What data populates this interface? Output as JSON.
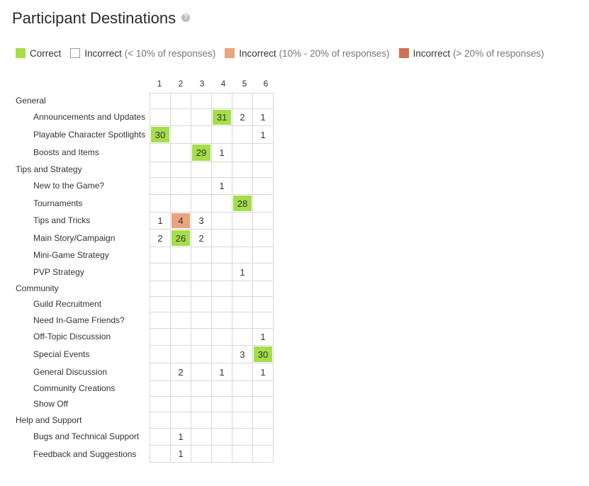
{
  "title": "Participant Destinations",
  "help_icon": "question-circle-icon",
  "colors": {
    "correct": "#a6dd4a",
    "incorrect_low": "#ffffff",
    "incorrect_mid": "#e8a47c",
    "incorrect_high": "#cd7253",
    "grid": "#d8d8d8"
  },
  "legend": {
    "correct": "Correct",
    "incorrect_label": "Incorrect",
    "incorrect_low_range": "(< 10% of responses)",
    "incorrect_mid_range": "(10% - 20% of responses)",
    "incorrect_high_range": "(> 20% of responses)"
  },
  "columns": [
    "1",
    "2",
    "3",
    "4",
    "5",
    "6"
  ],
  "rows": [
    {
      "label": "General",
      "type": "category",
      "cells": [
        "",
        "",
        "",
        "",
        "",
        ""
      ],
      "correct": null
    },
    {
      "label": "Announcements and Updates",
      "type": "sub",
      "cells": [
        "",
        "",
        "",
        "31",
        "2",
        "1"
      ],
      "correct": 3
    },
    {
      "label": "Playable Character Spotlights",
      "type": "sub",
      "cells": [
        "30",
        "",
        "",
        "",
        "",
        "1"
      ],
      "correct": 0
    },
    {
      "label": "Boosts and Items",
      "type": "sub",
      "cells": [
        "",
        "",
        "29",
        "1",
        "",
        ""
      ],
      "correct": 2
    },
    {
      "label": "Tips and Strategy",
      "type": "category",
      "cells": [
        "",
        "",
        "",
        "",
        "",
        ""
      ],
      "correct": null
    },
    {
      "label": "New to the Game?",
      "type": "sub",
      "cells": [
        "",
        "",
        "",
        "1",
        "",
        ""
      ],
      "correct": null
    },
    {
      "label": "Tournaments",
      "type": "sub",
      "cells": [
        "",
        "",
        "",
        "",
        "28",
        ""
      ],
      "correct": 4
    },
    {
      "label": "Tips and Tricks",
      "type": "sub",
      "cells": [
        "1",
        "4",
        "3",
        "",
        "",
        ""
      ],
      "correct": null,
      "incorrect_mid": 1
    },
    {
      "label": "Main Story/Campaign",
      "type": "sub",
      "cells": [
        "2",
        "26",
        "2",
        "",
        "",
        ""
      ],
      "correct": 1
    },
    {
      "label": "Mini-Game Strategy",
      "type": "sub",
      "cells": [
        "",
        "",
        "",
        "",
        "",
        ""
      ],
      "correct": null
    },
    {
      "label": "PVP Strategy",
      "type": "sub",
      "cells": [
        "",
        "",
        "",
        "",
        "1",
        ""
      ],
      "correct": null
    },
    {
      "label": "Community",
      "type": "category",
      "cells": [
        "",
        "",
        "",
        "",
        "",
        ""
      ],
      "correct": null
    },
    {
      "label": "Guild Recruitment",
      "type": "sub",
      "cells": [
        "",
        "",
        "",
        "",
        "",
        ""
      ],
      "correct": null
    },
    {
      "label": "Need In-Game Friends?",
      "type": "sub",
      "cells": [
        "",
        "",
        "",
        "",
        "",
        ""
      ],
      "correct": null
    },
    {
      "label": "Off-Topic Discussion",
      "type": "sub",
      "cells": [
        "",
        "",
        "",
        "",
        "",
        "1"
      ],
      "correct": null
    },
    {
      "label": "Special Events",
      "type": "sub",
      "cells": [
        "",
        "",
        "",
        "",
        "3",
        "30"
      ],
      "correct": 5
    },
    {
      "label": "General Discussion",
      "type": "sub",
      "cells": [
        "",
        "2",
        "",
        "1",
        "",
        "1"
      ],
      "correct": null
    },
    {
      "label": "Community Creations",
      "type": "sub",
      "cells": [
        "",
        "",
        "",
        "",
        "",
        ""
      ],
      "correct": null
    },
    {
      "label": "Show Off",
      "type": "sub",
      "cells": [
        "",
        "",
        "",
        "",
        "",
        ""
      ],
      "correct": null
    },
    {
      "label": "Help and Support",
      "type": "category",
      "cells": [
        "",
        "",
        "",
        "",
        "",
        ""
      ],
      "correct": null
    },
    {
      "label": "Bugs and Technical Support",
      "type": "sub",
      "cells": [
        "",
        "1",
        "",
        "",
        "",
        ""
      ],
      "correct": null
    },
    {
      "label": "Feedback and Suggestions",
      "type": "sub",
      "cells": [
        "",
        "1",
        "",
        "",
        "",
        ""
      ],
      "correct": null
    }
  ]
}
